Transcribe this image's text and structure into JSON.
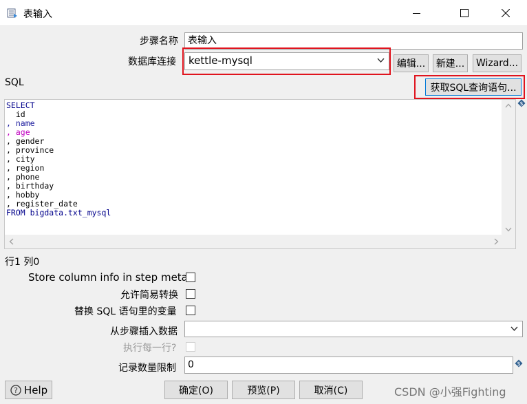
{
  "window": {
    "title": "表输入",
    "buttons": {
      "minimize": "minimize",
      "maximize": "maximize",
      "close": "close"
    }
  },
  "form": {
    "step_name_label": "步骤名称",
    "step_name_value": "表输入",
    "db_connection_label": "数据库连接",
    "db_connection_value": "kettle-mysql",
    "edit_button": "编辑...",
    "new_button": "新建...",
    "wizard_button": "Wizard...",
    "sql_label": "SQL",
    "get_sql_button": "获取SQL查询语句..."
  },
  "sql": {
    "lines": [
      "SELECT",
      "  id",
      ", name",
      ", age",
      ", gender",
      ", province",
      ", city",
      ", region",
      ", phone",
      ", birthday",
      ", hobby",
      ", register_date",
      "FROM bigdata.txt_mysql"
    ],
    "cursor_position": "行1 列0"
  },
  "options": {
    "store_column_info_label": "Store column info in step meta",
    "lazy_conversion_label": "允许简易转换",
    "replace_variables_label": "替换 SQL 语句里的变量",
    "insert_data_from_step_label": "从步骤插入数据",
    "insert_data_from_step_value": "",
    "execute_each_row_label": "执行每一行?",
    "limit_label": "记录数量限制",
    "limit_value": "0"
  },
  "footer": {
    "help_button": "Help",
    "ok_button": "确定(O)",
    "preview_button": "预览(P)",
    "cancel_button": "取消(C)",
    "watermark": "CSDN @小强Fighting"
  },
  "colors": {
    "highlight_border": "#e0141e",
    "sql_keyword": "#00008b",
    "sql_field_highlight": "#c000c0",
    "focused_button_border": "#0078d7"
  },
  "icons": {
    "app": "table-input-icon",
    "variable": "variable-dollar-icon",
    "help": "help-icon"
  }
}
